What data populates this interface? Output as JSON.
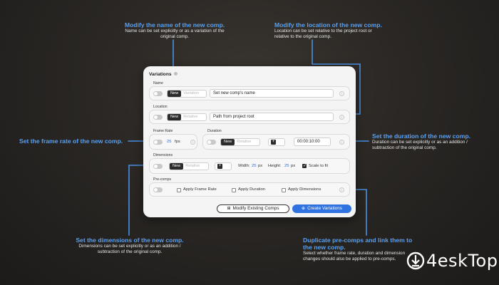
{
  "annotations": {
    "name": {
      "head": "Modify the name of the new comp.",
      "body1": "Name can be set explicitly or as a variation of the",
      "body2": "original comp."
    },
    "location": {
      "head": "Modify the location of the new comp.",
      "body1": "Location can be set relative to the project root or",
      "body2": "relative to the original comp."
    },
    "frame_rate": {
      "head": "Set the frame rate of the new comp."
    },
    "duration": {
      "head": "Set the duration of the new comp.",
      "body1": "Duration can be set explicitly or as an addition /",
      "body2": "subtraction of the original comp."
    },
    "dimensions": {
      "head": "Set the dimensions of the new comp.",
      "body1": "Dimensions can be set explicitly or as an addition /",
      "body2": "subtraction of the original comp."
    },
    "precomps": {
      "head": "Duplicate pre-comps and link them to",
      "head2": "the new comp.",
      "body1": "Select whether frame rate, duration and dimension",
      "body2": "changes should also be applied to pre-comps."
    }
  },
  "panel": {
    "title": "Variations",
    "name": {
      "label": "Name",
      "seg_on": "New",
      "seg_off": "Variation",
      "field": "Set new comp's name"
    },
    "location": {
      "label": "Location",
      "seg_on": "New",
      "seg_off": "Relative",
      "field": "Path from project root"
    },
    "frame_rate": {
      "label": "Frame Rate",
      "value": "25",
      "unit": "fps"
    },
    "duration": {
      "label": "Duration",
      "seg_on": "New",
      "seg_off": "Relative",
      "plus": "+",
      "value": "00:00:10:00"
    },
    "dimensions": {
      "label": "Dimensions",
      "seg_on": "New",
      "seg_off": "Relative",
      "plus": "+",
      "width_label": "Width:",
      "width_value": "25",
      "height_label": "Height:",
      "height_value": "25",
      "unit": "px",
      "scale_label": "Scale to fit"
    },
    "precomps": {
      "label": "Pre-comps",
      "opt1": "Apply Frame Rate",
      "opt2": "Apply Duration",
      "opt3": "Apply Dimensions"
    },
    "btn_modify": "Modify Existing Comps",
    "btn_create": "Create Variations"
  },
  "watermark": {
    "text": "4eskTop"
  },
  "colors": {
    "accent": "#5aa0ef",
    "primary_button": "#2f72e0",
    "panel": "#f4f4f4"
  }
}
